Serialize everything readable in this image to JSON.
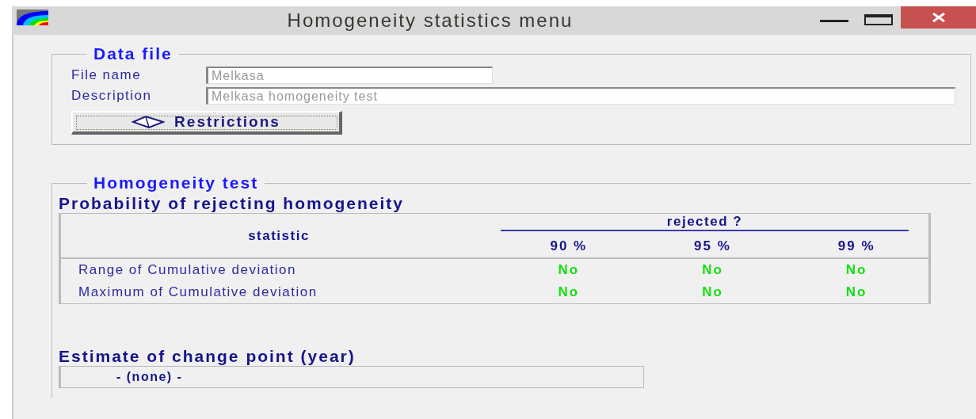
{
  "window": {
    "title": "Homogeneity statistics menu"
  },
  "data_file": {
    "title": "Data file",
    "fields": [
      {
        "label": "File name",
        "value": "Melkasa",
        "kind": "short"
      },
      {
        "label": "Description",
        "value": "Melkasa homogeneity test",
        "kind": "long"
      }
    ],
    "button": "Restrictions"
  },
  "homogeneity_test": {
    "title": "Homogeneity test",
    "subtitle": "Probability of rejecting homogeneity",
    "table": {
      "columns": [
        "statistic",
        "90 %",
        "95 %",
        "99 %"
      ],
      "group_header": "rejected ?",
      "rows": [
        {
          "cells": [
            "Range of Cumulative deviation",
            "No",
            "No",
            "No"
          ]
        },
        {
          "cells": [
            "Maximum of Cumulative deviation",
            "No",
            "No",
            "No"
          ]
        }
      ]
    },
    "change_point": {
      "title": "Estimate of change point (year)",
      "value": "- (none) -"
    }
  }
}
